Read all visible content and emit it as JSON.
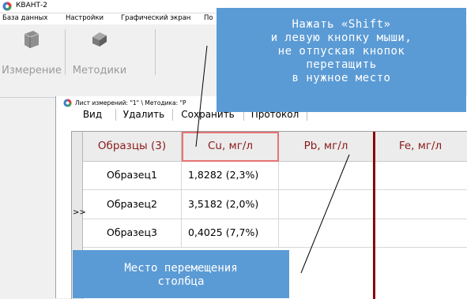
{
  "app": {
    "title": "КВАНТ-2",
    "icon": "app-logo-icon"
  },
  "menu": {
    "items": [
      "База данных",
      "Настройки",
      "Графический экран",
      "По"
    ]
  },
  "toolbar": {
    "measure_label": "Измерение",
    "methods_label": "Методики"
  },
  "inner": {
    "title": "Лист измерений: \"1\" \\ Методика: \"Р",
    "tabs": [
      "Вид",
      "Удалить",
      "Сохранить",
      "Протокол"
    ]
  },
  "grid": {
    "row_arrow": ">>",
    "headers": [
      "Образцы (3)",
      "Cu, мг/л",
      "Pb, мг/л",
      "Fe, мг/л"
    ],
    "rows": [
      {
        "name": "Образец1",
        "cu": "1,8282 (2,3%)"
      },
      {
        "name": "Образец2",
        "cu": "3,5182 (2,0%)"
      },
      {
        "name": "Образец3",
        "cu": "0,4025 (7,7%)"
      }
    ]
  },
  "callouts": {
    "top_lines": [
      "Нажать «Shift»",
      "и левую кнопку мыши,",
      "не отпуская кнопок",
      "перетащить",
      "в нужное место"
    ],
    "bottom_lines": [
      "Место перемещения",
      "столбца"
    ]
  },
  "colors": {
    "callout": "#5b9bd5",
    "header_text": "#8b1a1a",
    "highlight_border": "#e57373",
    "drop_line": "#8b0000"
  }
}
